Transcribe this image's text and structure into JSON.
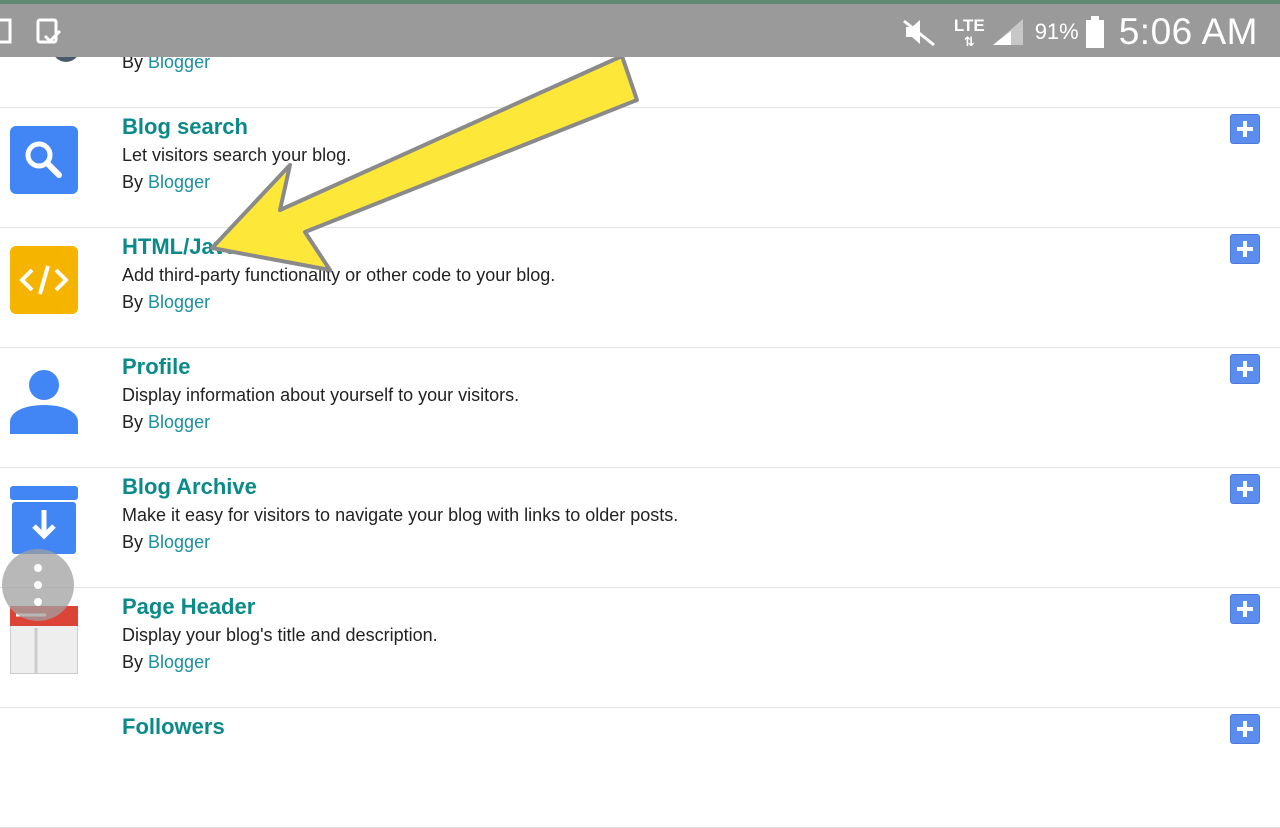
{
  "status_bar": {
    "network": "LTE",
    "battery": "91%",
    "time": "5:06 AM"
  },
  "widgets": [
    {
      "title": "",
      "description": "",
      "by_prefix": "By",
      "author": "Blogger",
      "icon": "add-picture-icon"
    },
    {
      "title": "Blog search",
      "description": "Let visitors search your blog.",
      "by_prefix": "By",
      "author": "Blogger",
      "icon": "search-icon"
    },
    {
      "title": "HTML/JavaScript",
      "description": "Add third-party functionality or other code to your blog.",
      "by_prefix": "By",
      "author": "Blogger",
      "icon": "code-icon"
    },
    {
      "title": "Profile",
      "description": "Display information about yourself to your visitors.",
      "by_prefix": "By",
      "author": "Blogger",
      "icon": "person-icon"
    },
    {
      "title": "Blog Archive",
      "description": "Make it easy for visitors to navigate your blog with links to older posts.",
      "by_prefix": "By",
      "author": "Blogger",
      "icon": "archive-icon"
    },
    {
      "title": "Page Header",
      "description": "Display your blog's title and description.",
      "by_prefix": "By",
      "author": "Blogger",
      "icon": "page-header-icon"
    },
    {
      "title": "Followers",
      "description": "",
      "by_prefix": "",
      "author": "",
      "icon": "followers-icon"
    }
  ],
  "colors": {
    "title": "#0b8a8a",
    "link": "#1a8f9f",
    "add_button": "#5b8def",
    "annotation_arrow": "#fde83a"
  }
}
